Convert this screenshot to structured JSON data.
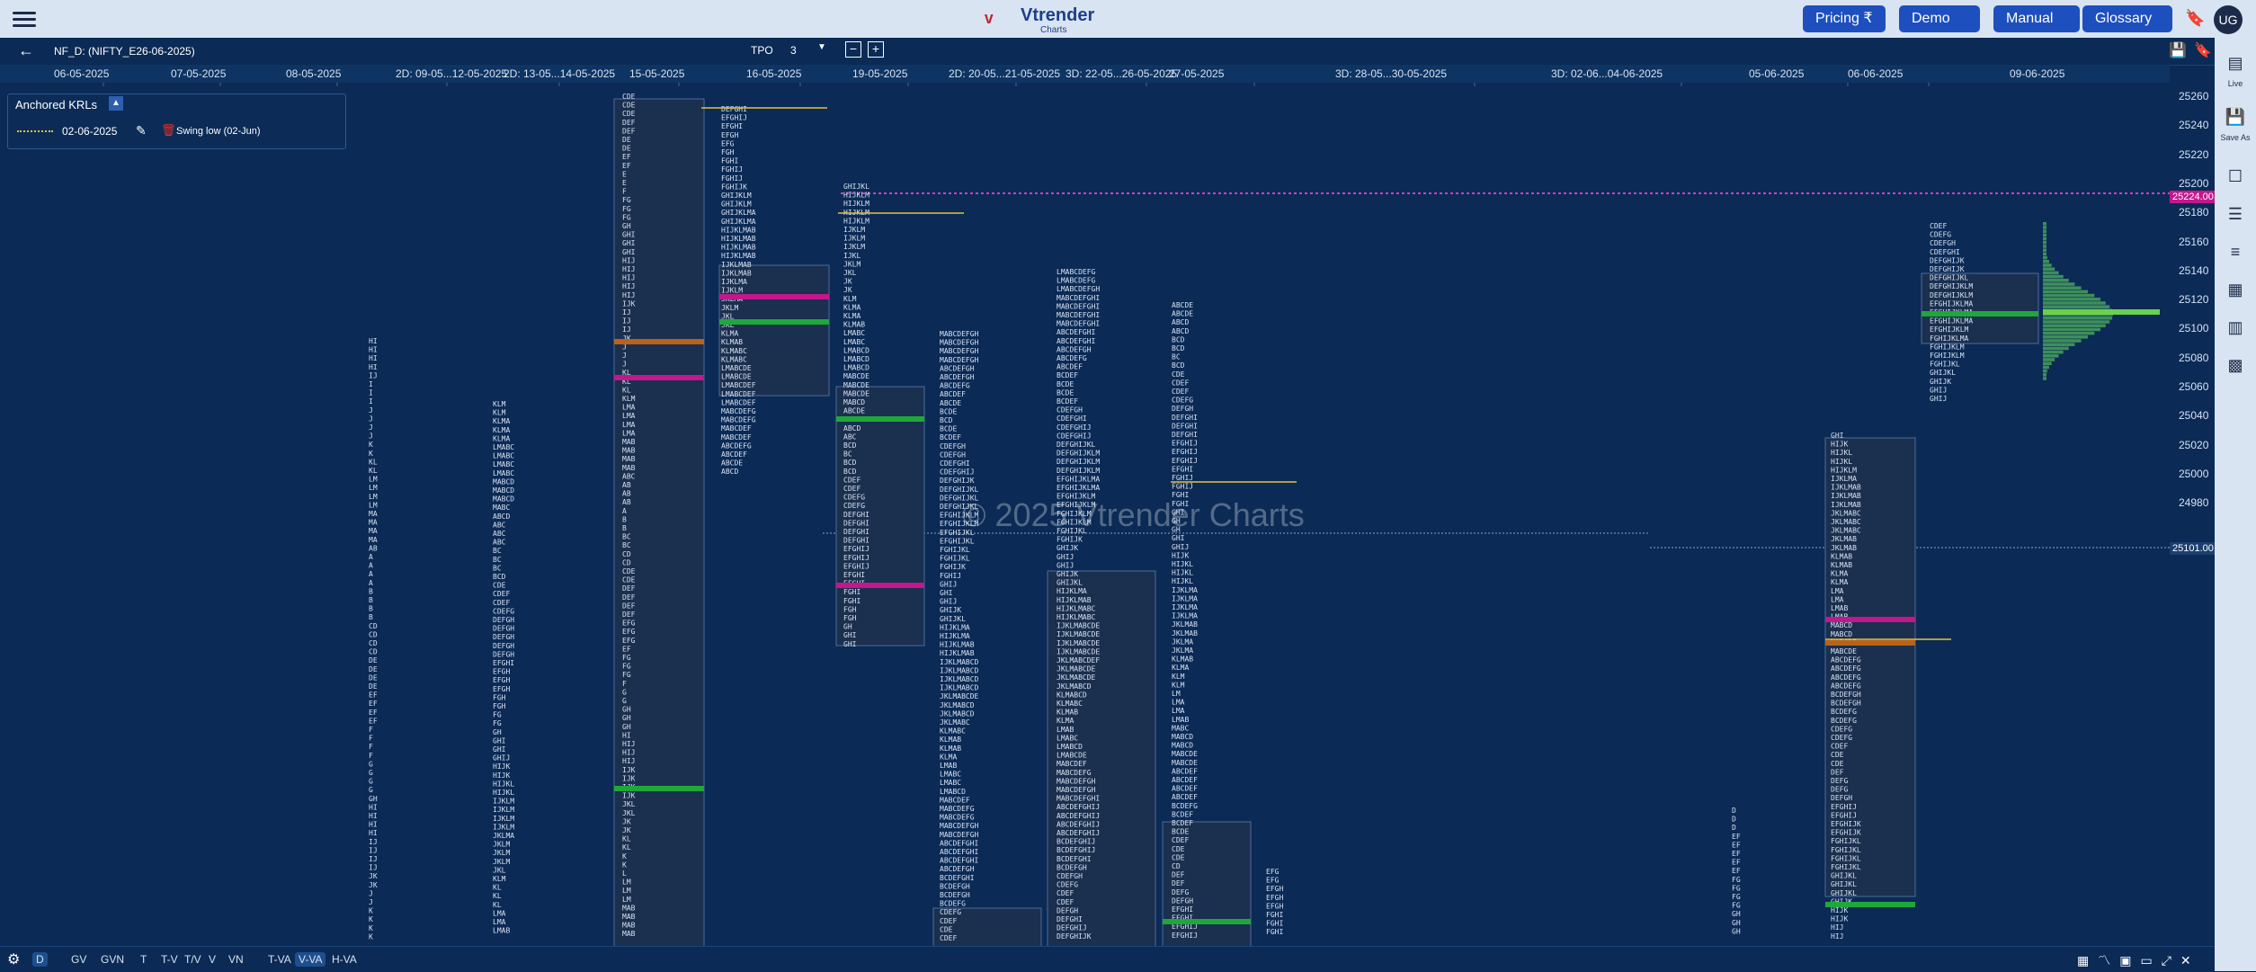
{
  "header": {
    "brand_name": "Vtrender",
    "brand_sub": "Charts",
    "buttons": [
      "Pricing ₹",
      "Demo",
      "Manual",
      "Glossary"
    ],
    "user_initials": "UG"
  },
  "toolbar": {
    "symbol": "NF_D: (NIFTY_E26-06-2025)",
    "tpo_label": "TPO",
    "tpo_value": "3"
  },
  "date_labels": [
    "06-05-2025",
    "07-05-2025",
    "08-05-2025",
    "2D: 09-05...12-05-2025",
    "2D: 13-05...14-05-2025",
    "15-05-2025",
    "16-05-2025",
    "19-05-2025",
    "2D: 20-05...21-05-2025",
    "3D: 22-05...26-05-2025",
    "27-05-2025",
    "3D: 28-05...30-05-2025",
    "3D: 02-06...04-06-2025",
    "05-06-2025",
    "06-06-2025",
    "09-06-2025"
  ],
  "price_labels": [
    "25260",
    "25240",
    "25220",
    "25200",
    "25180",
    "25160",
    "25140",
    "25120",
    "25100",
    "25080",
    "25060",
    "25040",
    "25020",
    "25000",
    "24980"
  ],
  "price_tags": {
    "top": "25224.00",
    "mid": "25101.00"
  },
  "krl_panel": {
    "title": "Anchored KRLs",
    "date": "02-06-2025",
    "note": "Swing low (02-Jun)"
  },
  "watermark": "© 2025 Vtrender Charts",
  "right_panel": {
    "live_label": "Live",
    "save_label": "Save As"
  },
  "bottom_tabs": [
    "D",
    "GV",
    "GVN",
    "T",
    "T-V",
    "T/V",
    "V",
    "VN",
    "T-VA",
    "V-VA",
    "H-VA"
  ],
  "colors": {
    "background": "#0b2a55",
    "poc": "#c2188c",
    "value_area": "#1fa83a",
    "ib": "#e6c33b",
    "single_print": "#b8621b"
  }
}
